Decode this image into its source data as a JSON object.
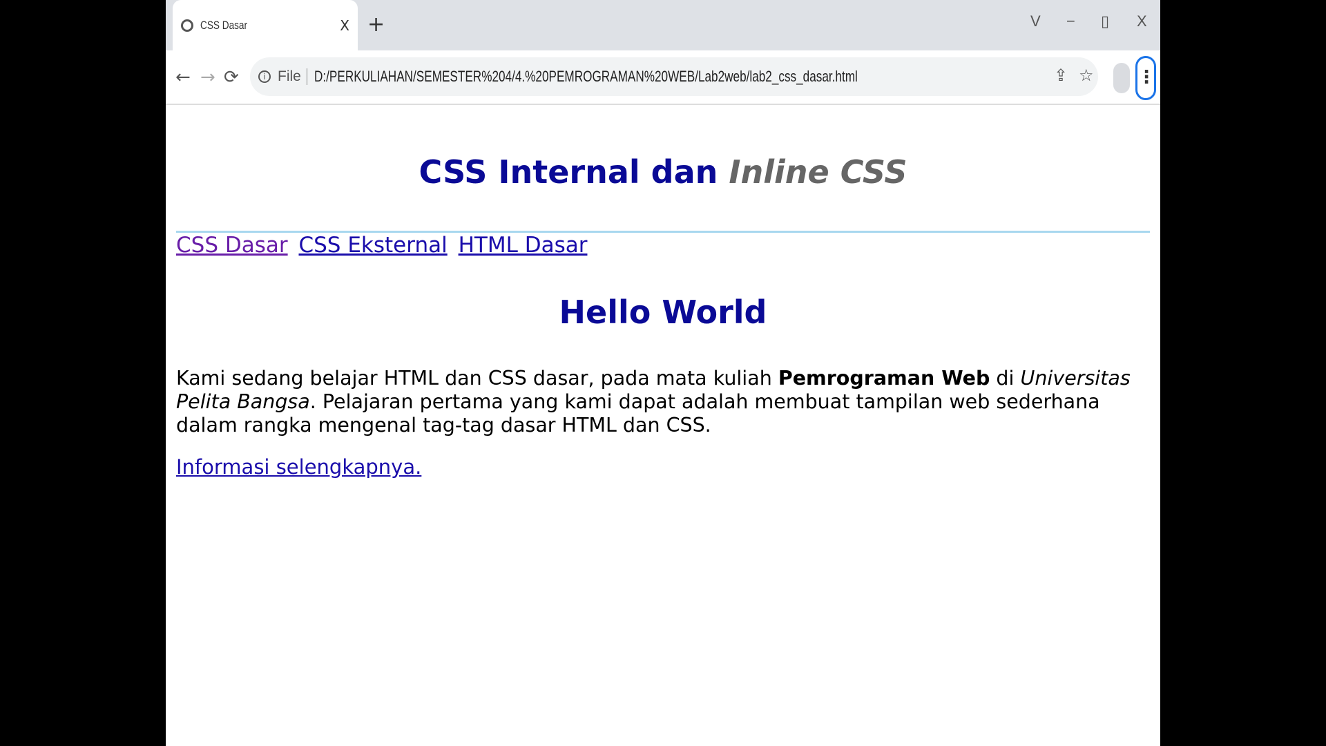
{
  "tab": {
    "title": "CSS Dasar",
    "close": "X",
    "new_tab": "+"
  },
  "window_controls": {
    "list": "V",
    "minimize": "−",
    "restore": "▯",
    "close": "X"
  },
  "toolbar": {
    "back": "←",
    "forward": "→",
    "reload": "⟳",
    "info": "i",
    "scheme": "File",
    "url": "D:/PERKULIAHAN/SEMESTER%204/4.%20PEMROGRAMAN%20WEB/Lab2web/lab2_css_dasar.html",
    "share": "⇪",
    "bookmark": "☆",
    "menu": "⋮"
  },
  "page": {
    "heading_normal": "CSS Internal dan ",
    "heading_italic": "Inline CSS",
    "nav_links": [
      "CSS Dasar",
      "CSS Eksternal",
      "HTML Dasar"
    ],
    "subheading": "Hello World",
    "para_1": "Kami sedang belajar HTML dan CSS dasar, pada mata kuliah ",
    "para_bold": "Pemrograman Web",
    "para_2": " di ",
    "para_italic": "Universitas Pelita Bangsa",
    "para_3": ". Pelajaran pertama yang kami dapat adalah membuat tampilan web sederhana dalam rangka mengenal tag-tag dasar HTML dan CSS.",
    "more_link": "Informasi selengkapnya."
  },
  "colors": {
    "heading": "#0a0a96",
    "italic_heading": "#666666",
    "link": "#1a0dab",
    "visited": "#681da8",
    "rule": "#a8d8ef"
  }
}
